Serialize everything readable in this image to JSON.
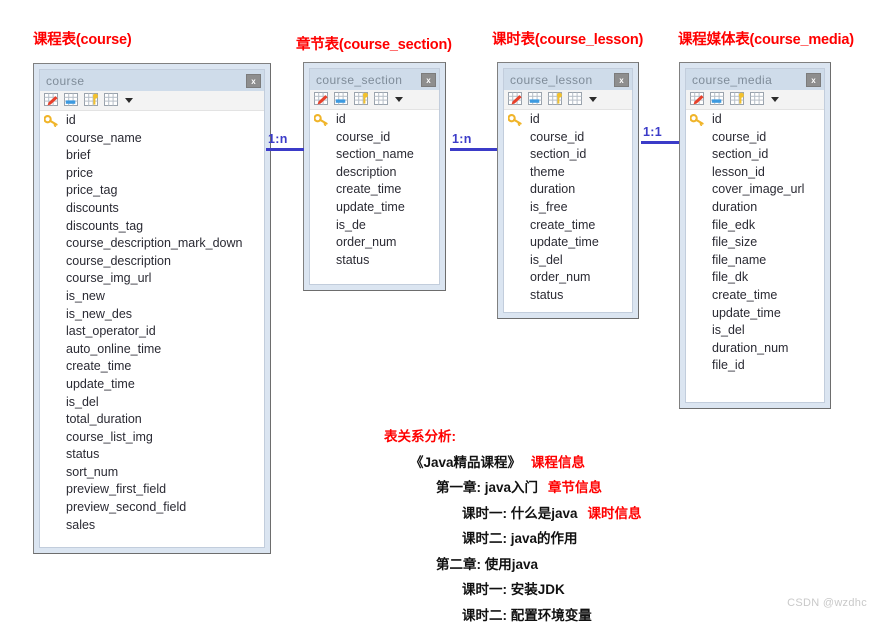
{
  "diagram": {
    "type": "er-diagram",
    "watermark": "CSDN @wzdhc"
  },
  "tables": [
    {
      "caption": "课程表(course)",
      "title": "course",
      "close_label": "x",
      "fields": [
        "id",
        "course_name",
        "brief",
        "price",
        "price_tag",
        "discounts",
        "discounts_tag",
        "course_description_mark_down",
        "course_description",
        "course_img_url",
        "is_new",
        "is_new_des",
        "last_operator_id",
        "auto_online_time",
        "create_time",
        "update_time",
        "is_del",
        "total_duration",
        "course_list_img",
        "status",
        "sort_num",
        "preview_first_field",
        "preview_second_field",
        "sales"
      ],
      "primary_key": "id"
    },
    {
      "caption": "章节表(course_section)",
      "title": "course_section",
      "close_label": "x",
      "fields": [
        "id",
        "course_id",
        "section_name",
        "description",
        "create_time",
        "update_time",
        "is_de",
        "order_num",
        "status"
      ],
      "primary_key": "id"
    },
    {
      "caption": "课时表(course_lesson)",
      "title": "course_lesson",
      "close_label": "x",
      "fields": [
        "id",
        "course_id",
        "section_id",
        "theme",
        "duration",
        "is_free",
        "create_time",
        "update_time",
        "is_del",
        "order_num",
        "status"
      ],
      "primary_key": "id"
    },
    {
      "caption": "课程媒体表(course_media)",
      "title": "course_media",
      "close_label": "x",
      "fields": [
        "id",
        "course_id",
        "section_id",
        "lesson_id",
        "cover_image_url",
        "duration",
        "file_edk",
        "file_size",
        "file_name",
        "file_dk",
        "create_time",
        "update_time",
        "is_del",
        "duration_num",
        "file_id"
      ],
      "primary_key": "id"
    }
  ],
  "relationships": [
    {
      "label": "1:n",
      "from": "course",
      "to": "course_section"
    },
    {
      "label": "1:n",
      "from": "course_section",
      "to": "course_lesson"
    },
    {
      "label": "1:1",
      "from": "course_lesson",
      "to": "course_media"
    }
  ],
  "analysis": {
    "heading": "表关系分析:",
    "rows": [
      {
        "indent": 1,
        "text": "《Java精品课程》",
        "note": "课程信息"
      },
      {
        "indent": 2,
        "text": "第一章: java入门",
        "note": "章节信息"
      },
      {
        "indent": 3,
        "text": "课时一: 什么是java",
        "note": "课时信息"
      },
      {
        "indent": 3,
        "text": "课时二: java的作用",
        "note": ""
      },
      {
        "indent": 2,
        "text": "第二章: 使用java",
        "note": ""
      },
      {
        "indent": 3,
        "text": "课时一: 安装JDK",
        "note": ""
      },
      {
        "indent": 3,
        "text": "课时二: 配置环境变量",
        "note": ""
      }
    ]
  },
  "colors": {
    "caption_red": "#ff0000",
    "relation_blue": "#3b3bc8",
    "table_frame": "#dbe5f1",
    "titlebar": "#cfdcea",
    "key_icon": "#f0b429"
  }
}
